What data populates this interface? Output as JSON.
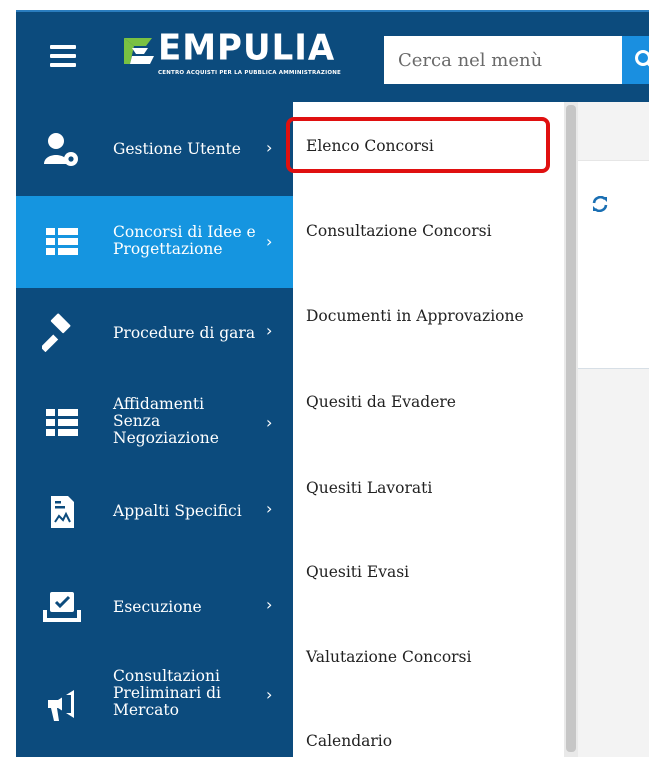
{
  "header": {
    "logo_text": "EMPULIA",
    "logo_tagline": "CENTRO ACQUISTI PER LA PUBBLICA AMMINISTRAZIONE",
    "search_placeholder": "Cerca nel menù"
  },
  "sidebar": {
    "items": [
      {
        "label_lines": [
          "Gestione Utente"
        ],
        "icon": "user-gear-icon",
        "active": false
      },
      {
        "label_lines": [
          "Concorsi di Idee e",
          "Progettazione"
        ],
        "icon": "list-icon",
        "active": true
      },
      {
        "label_lines": [
          "Procedure di gara"
        ],
        "icon": "gavel-icon",
        "active": false
      },
      {
        "label_lines": [
          "Affidamenti",
          "Senza",
          "Negoziazione"
        ],
        "icon": "list-icon",
        "active": false
      },
      {
        "label_lines": [
          "Appalti Specifici"
        ],
        "icon": "document-chart-icon",
        "active": false
      },
      {
        "label_lines": [
          "Esecuzione"
        ],
        "icon": "checkbox-tray-icon",
        "active": false
      },
      {
        "label_lines": [
          "Consultazioni",
          "Preliminari di",
          "Mercato"
        ],
        "icon": "megaphone-icon",
        "active": false
      }
    ],
    "chevron": "›"
  },
  "submenu": {
    "items": [
      "Elenco Concorsi",
      "Consultazione Concorsi",
      "Documenti in Approvazione",
      "Quesiti da Evadere",
      "Quesiti Lavorati",
      "Quesiti Evasi",
      "Valutazione Concorsi",
      "Calendario"
    ],
    "highlighted_index": 0
  },
  "colors": {
    "header_bg": "#0c4b7d",
    "sidebar_bg": "#0c4b7d",
    "active_bg": "#1595e0",
    "search_button": "#1a8fe0",
    "highlight_border": "#e01010",
    "logo_accent": "#7ac142"
  }
}
